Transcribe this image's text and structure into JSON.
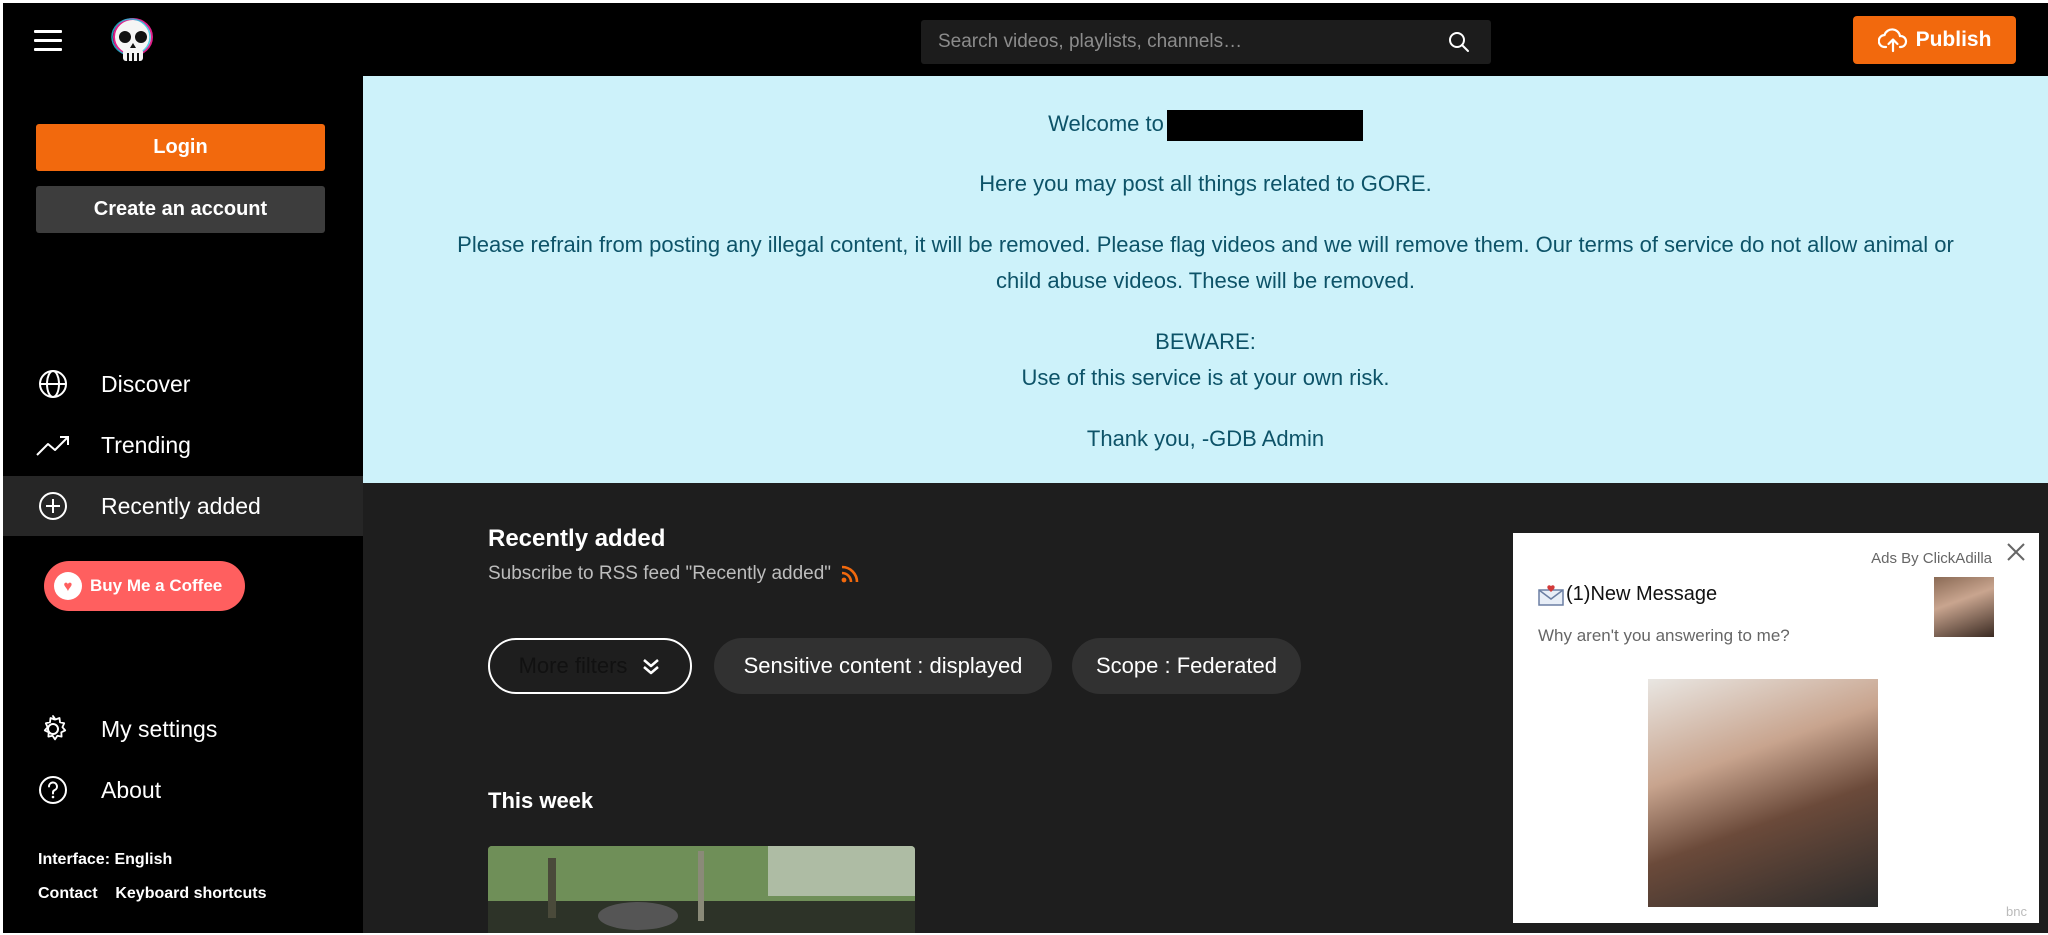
{
  "header": {
    "search_placeholder": "Search videos, playlists, channels…",
    "publish_label": "Publish",
    "accent_color": "#f2690d"
  },
  "sidebar": {
    "login_label": "Login",
    "create_account_label": "Create an account",
    "nav": [
      {
        "label": "Discover",
        "icon": "globe-icon"
      },
      {
        "label": "Trending",
        "icon": "trending-icon"
      },
      {
        "label": "Recently added",
        "icon": "plus-circle-icon",
        "active": true
      }
    ],
    "coffee_label": "Buy Me a Coffee",
    "settings": [
      {
        "label": "My settings",
        "icon": "gear-icon"
      },
      {
        "label": "About",
        "icon": "question-icon"
      }
    ],
    "interface_label": "Interface: English",
    "contact_label": "Contact",
    "shortcuts_label": "Keyboard shortcuts"
  },
  "banner": {
    "welcome": "Welcome to",
    "line1": "Here you may post all things related to GORE.",
    "line2a": "Please refrain from posting any illegal content, it will be removed. Please flag videos and we will remove them. Our terms of service do not allow animal or",
    "line2b": "child abuse videos. These will be removed.",
    "beware": "BEWARE:",
    "risk": "Use of this service is at your own risk.",
    "thanks": "Thank you, -GDB Admin"
  },
  "main": {
    "title": "Recently added",
    "rss_label": "Subscribe to RSS feed \"Recently added\"",
    "filters": {
      "more_filters": "More filters",
      "sensitive": "Sensitive content : displayed",
      "scope": "Scope : Federated"
    },
    "section_title": "This week"
  },
  "ad": {
    "by": "Ads By ClickAdilla",
    "message": "(1)New Message",
    "subtext": "Why aren't you answering to me?",
    "footer": "bnc"
  }
}
